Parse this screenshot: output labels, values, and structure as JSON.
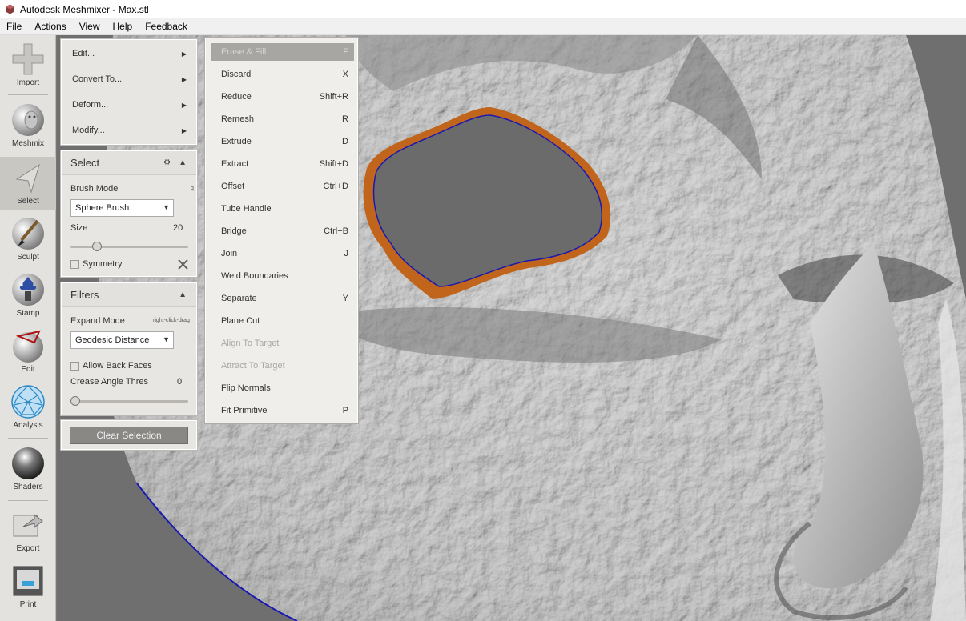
{
  "window": {
    "title": "Autodesk Meshmixer - Max.stl"
  },
  "menubar": {
    "items": [
      "File",
      "Actions",
      "View",
      "Help",
      "Feedback"
    ]
  },
  "toolbar": {
    "tools": [
      {
        "label": "Import",
        "icon": "plus-icon"
      },
      {
        "label": "Meshmix",
        "icon": "meshmix-head-icon"
      },
      {
        "label": "Select",
        "icon": "select-arrow-icon",
        "active": true
      },
      {
        "label": "Sculpt",
        "icon": "sculpt-brush-icon"
      },
      {
        "label": "Stamp",
        "icon": "stamp-icon"
      },
      {
        "label": "Edit",
        "icon": "edit-sphere-icon"
      },
      {
        "label": "Analysis",
        "icon": "analysis-mesh-icon"
      },
      {
        "label": "Shaders",
        "icon": "shaders-sphere-icon"
      },
      {
        "label": "Export",
        "icon": "export-icon"
      },
      {
        "label": "Print",
        "icon": "print-icon"
      }
    ]
  },
  "edit_submenu": {
    "items": [
      "Edit...",
      "Convert To...",
      "Deform...",
      "Modify..."
    ]
  },
  "select_panel": {
    "title": "Select",
    "brush_mode_label": "Brush Mode",
    "brush_mode_hint": "q",
    "brush_mode_value": "Sphere Brush",
    "size_label": "Size",
    "size_value": "20",
    "size_fraction": 0.2,
    "symmetry_label": "Symmetry"
  },
  "filters_panel": {
    "title": "Filters",
    "expand_mode_label": "Expand Mode",
    "expand_mode_hint": "right-click-drag",
    "expand_mode_value": "Geodesic Distance",
    "allow_back_faces_label": "Allow Back Faces",
    "crease_label": "Crease Angle Thres",
    "crease_value": "0",
    "crease_fraction": 0
  },
  "clear_selection_label": "Clear Selection",
  "context_menu": {
    "items": [
      {
        "label": "Erase & Fill",
        "key": "F",
        "state": "highlight"
      },
      {
        "label": "Discard",
        "key": "X"
      },
      {
        "label": "Reduce",
        "key": "Shift+R"
      },
      {
        "label": "Remesh",
        "key": "R"
      },
      {
        "label": "Extrude",
        "key": "D"
      },
      {
        "label": "Extract",
        "key": "Shift+D"
      },
      {
        "label": "Offset",
        "key": "Ctrl+D"
      },
      {
        "label": "Tube Handle",
        "key": ""
      },
      {
        "label": "Bridge",
        "key": "Ctrl+B"
      },
      {
        "label": "Join",
        "key": "J"
      },
      {
        "label": "Weld Boundaries",
        "key": ""
      },
      {
        "label": "Separate",
        "key": "Y"
      },
      {
        "label": "Plane Cut",
        "key": ""
      },
      {
        "label": "Align To Target",
        "key": "",
        "state": "disabled"
      },
      {
        "label": "Attract To Target",
        "key": "",
        "state": "disabled"
      },
      {
        "label": "Flip Normals",
        "key": ""
      },
      {
        "label": "Fit Primitive",
        "key": "P"
      }
    ]
  },
  "colors": {
    "mesh": "#c9c9c9",
    "hole": "#6b6b6b",
    "selection_edge": "#c0651b",
    "boundary": "#1a1ab0"
  }
}
